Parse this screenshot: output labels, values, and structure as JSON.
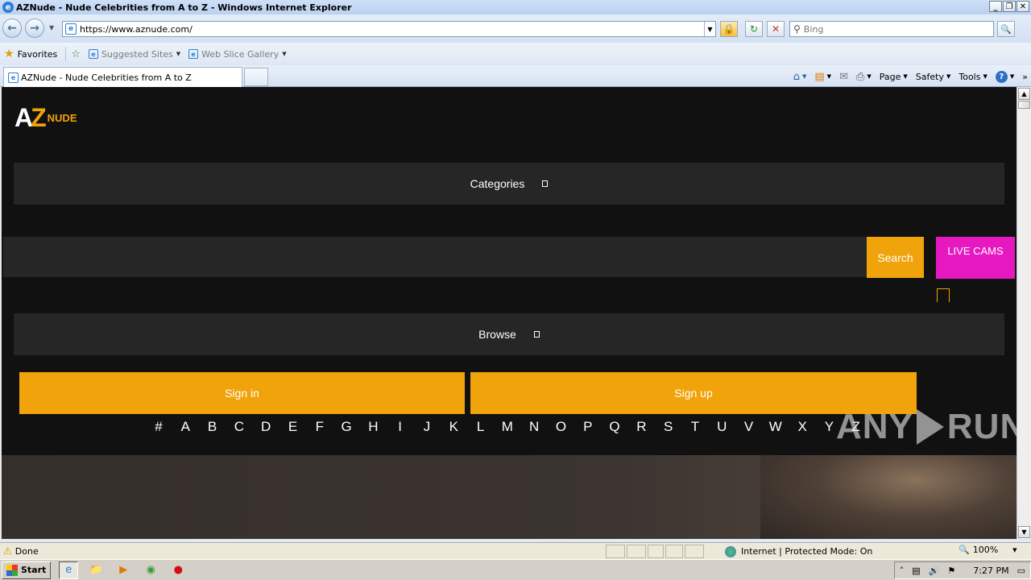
{
  "window": {
    "title": "AZNude - Nude Celebrities from A to Z - Windows Internet Explorer",
    "controls": [
      "_",
      "❐",
      "✕"
    ]
  },
  "address_bar": {
    "url": "https://www.aznude.com/",
    "search_placeholder": "Bing"
  },
  "favorites_bar": {
    "favorites_label": "Favorites",
    "links": [
      "Suggested Sites",
      "Web Slice Gallery"
    ]
  },
  "tabs": [
    {
      "label": "AZNude - Nude Celebrities from A to Z",
      "active": true
    }
  ],
  "command_bar": {
    "page_label": "Page",
    "safety_label": "Safety",
    "tools_label": "Tools"
  },
  "site": {
    "logo": {
      "az_a": "A",
      "az_z": "Z",
      "nude": "NUDE"
    },
    "categories_label": "Categories",
    "search_button": "Search",
    "live_cams": "LIVE CAMS",
    "browse_label": "Browse",
    "sign_in": "Sign in",
    "sign_up": "Sign up",
    "letters": [
      "#",
      "A",
      "B",
      "C",
      "D",
      "E",
      "F",
      "G",
      "H",
      "I",
      "J",
      "K",
      "L",
      "M",
      "N",
      "O",
      "P",
      "Q",
      "R",
      "S",
      "T",
      "U",
      "V",
      "W",
      "X",
      "Y",
      "Z"
    ],
    "accent_color": "#f0a30a",
    "live_color": "#e619c1"
  },
  "watermark": {
    "left": "ANY",
    "right": "RUN"
  },
  "status_bar": {
    "status": "Done",
    "zone": "Internet | Protected Mode: On",
    "zoom": "100%"
  },
  "taskbar": {
    "start": "Start",
    "clock": "7:27 PM"
  }
}
